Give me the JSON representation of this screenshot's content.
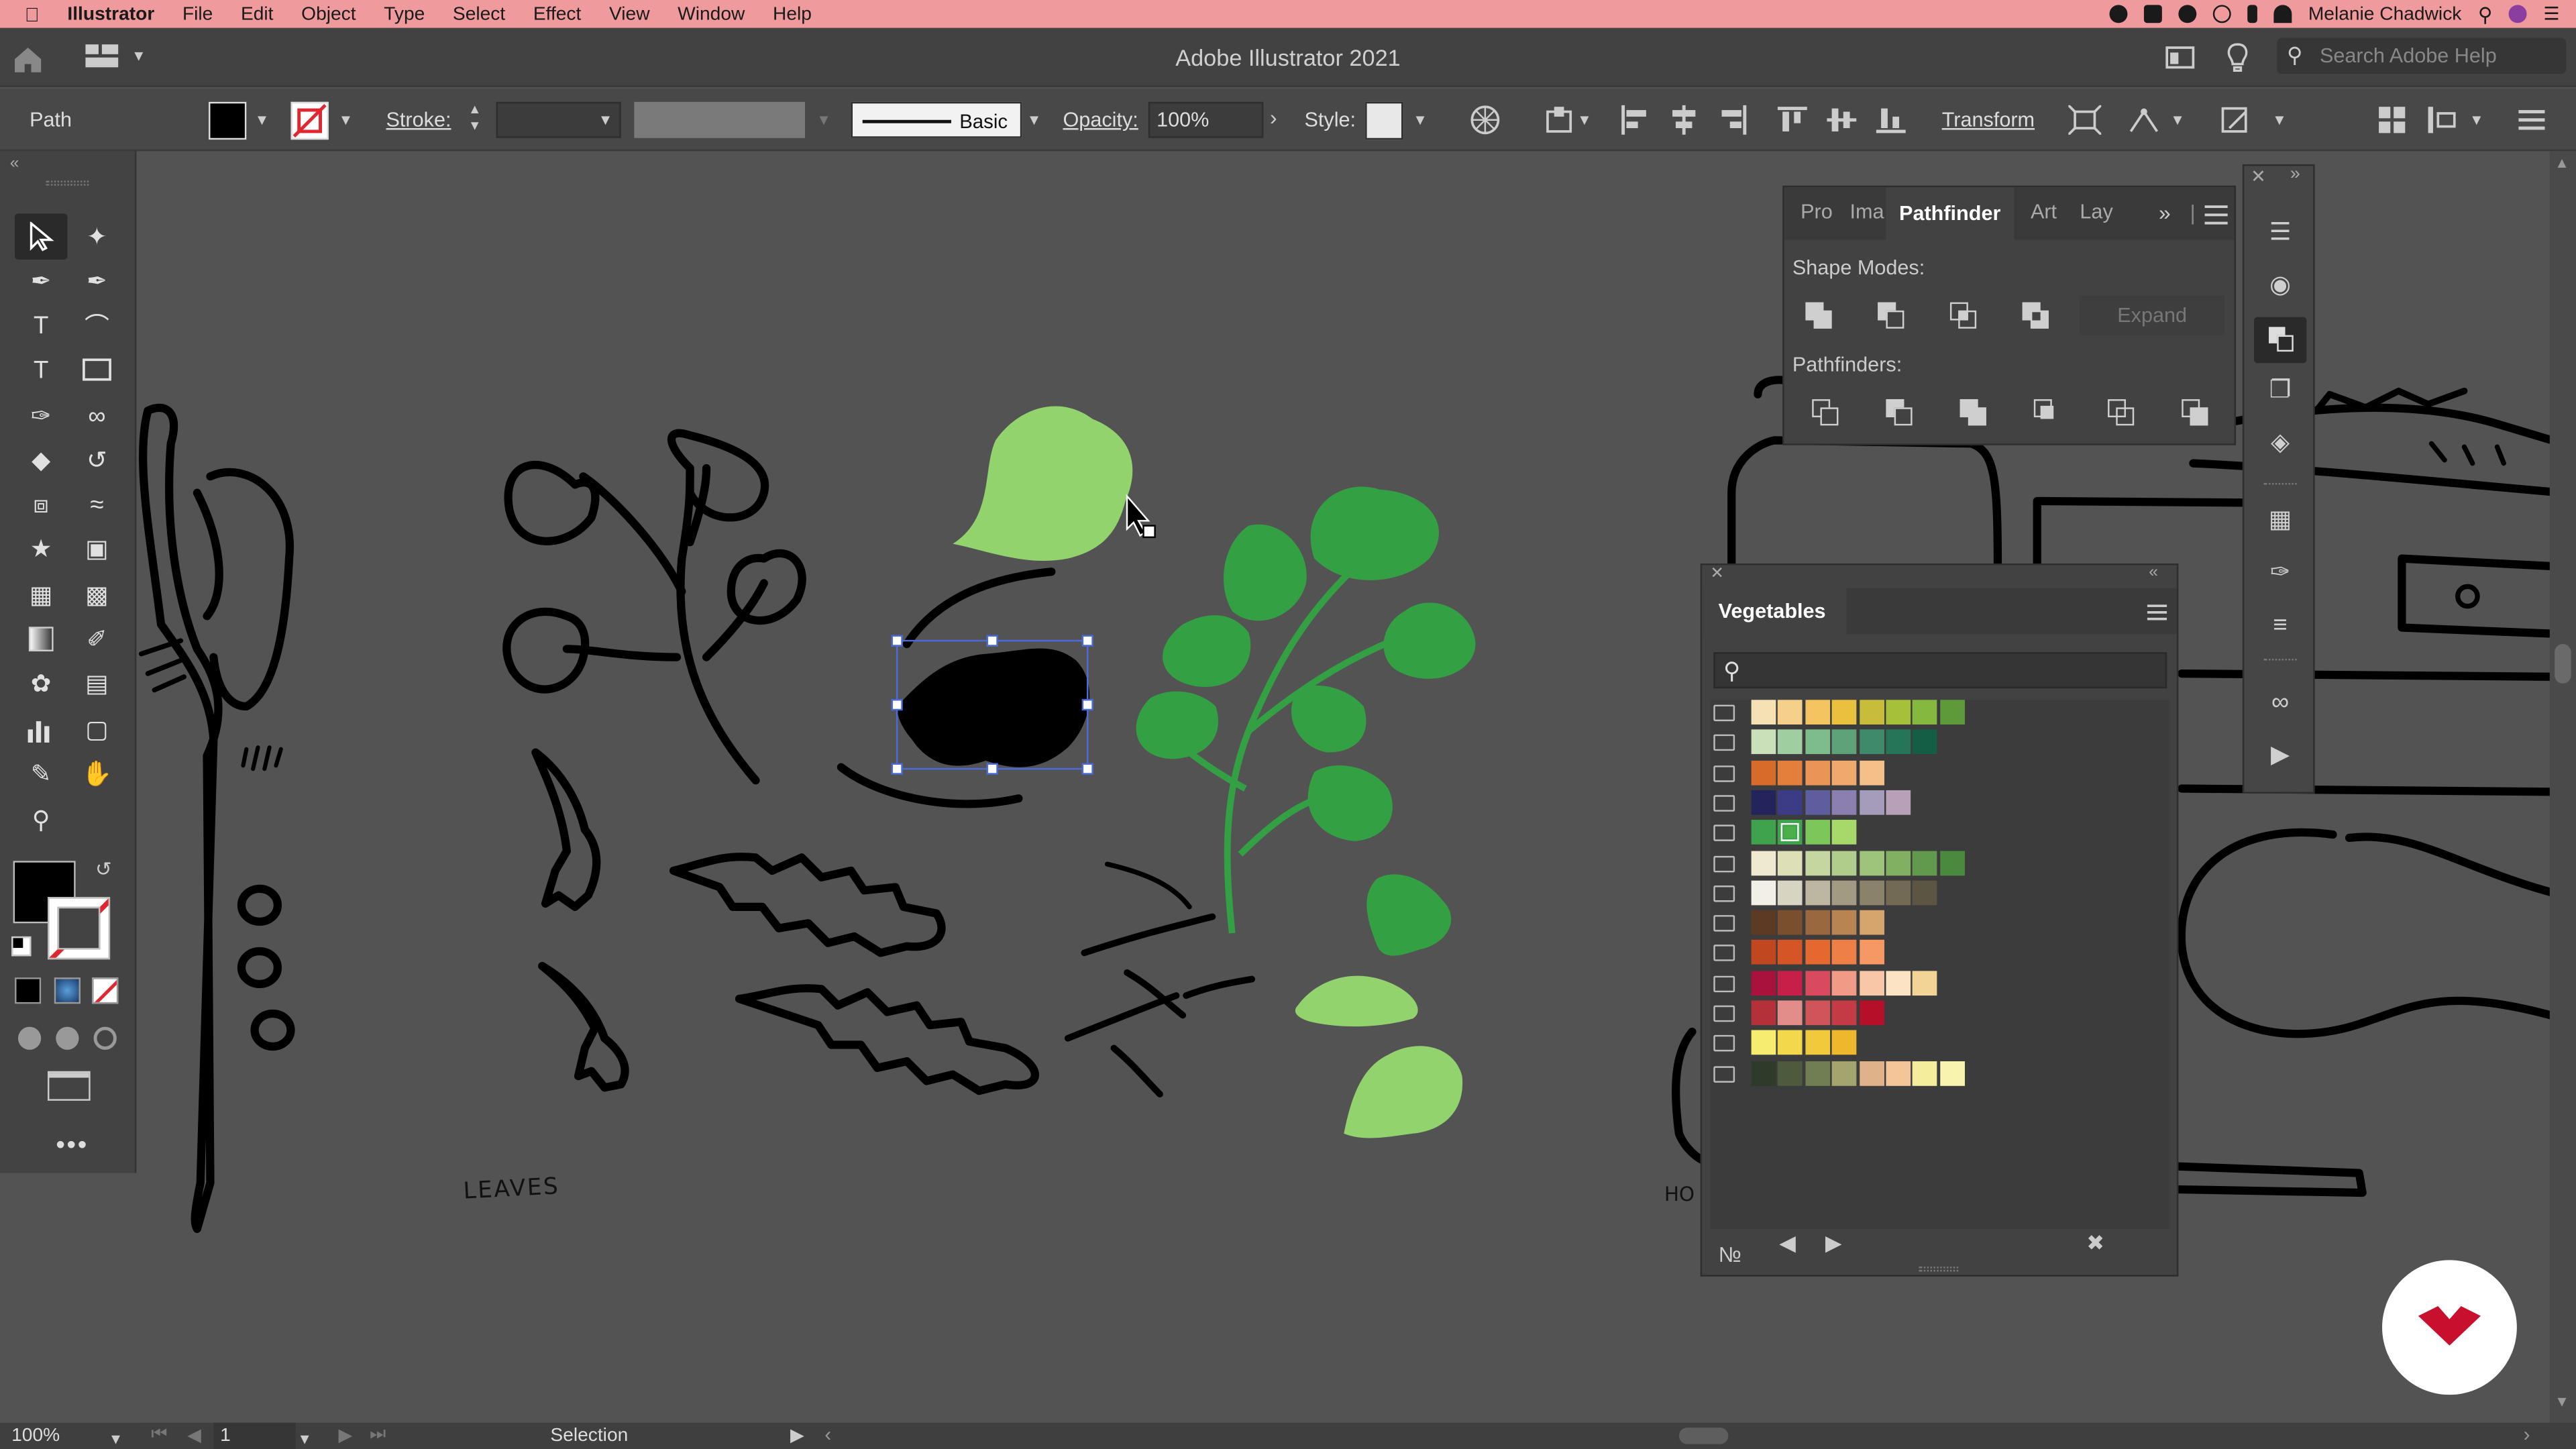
{
  "menubar": {
    "app": "Illustrator",
    "items": [
      "File",
      "Edit",
      "Object",
      "Type",
      "Select",
      "Effect",
      "View",
      "Window",
      "Help"
    ],
    "user": "Melanie Chadwick"
  },
  "titlebar": {
    "title": "Adobe Illustrator 2021",
    "search_placeholder": "Search Adobe Help"
  },
  "controlbar": {
    "selection_type": "Path",
    "stroke_label": "Stroke:",
    "brush_label": "Basic",
    "opacity_label": "Opacity:",
    "opacity_value": "100%",
    "style_label": "Style:",
    "transform_label": "Transform"
  },
  "pathfinder_panel": {
    "tabs": [
      "Pro",
      "Ima",
      "Pathfinder",
      "Art",
      "Lay"
    ],
    "active_tab": "Pathfinder",
    "shape_modes_label": "Shape Modes:",
    "expand_label": "Expand",
    "pathfinders_label": "Pathfinders:"
  },
  "swatches_panel": {
    "title": "Vegetables",
    "groups": [
      [
        "#f4e2b4",
        "#f5d08a",
        "#f3c45f",
        "#e9c13e",
        "#c8bd3a",
        "#a6c03a",
        "#84b83e",
        "#5f9a3a"
      ],
      [
        "#c9e0b9",
        "#9fcea0",
        "#7fbc8b",
        "#5ea27a",
        "#3f8a6a",
        "#267558",
        "#135e44"
      ],
      [
        "#d66b2a",
        "#e37f3a",
        "#ea9455",
        "#f0a96d",
        "#f5bf8a"
      ],
      [
        "#24245c",
        "#3b3b86",
        "#5e5e9e",
        "#8b7fb0",
        "#a59bbb",
        "#b8a0b8"
      ],
      [
        "#3fa34d",
        "#4cb04a",
        "#7dc75a",
        "#a6d86a"
      ],
      [
        "#efe9cf",
        "#dde0b6",
        "#c6d6a0",
        "#b1cd8b",
        "#9ec37a",
        "#82b063",
        "#629a4d",
        "#4a8a3f"
      ],
      [
        "#f2f0e6",
        "#d8d4c2",
        "#bdb6a0",
        "#a29a82",
        "#8a826a",
        "#726a55",
        "#5c5544"
      ],
      [
        "#5c3a23",
        "#7a4f2e",
        "#99683f",
        "#b88552",
        "#d6a56e"
      ],
      [
        "#c0471f",
        "#d65526",
        "#e5692f",
        "#ee7f47",
        "#f59863"
      ],
      [
        "#a8123d",
        "#c81f48",
        "#d94a5f",
        "#f19b86",
        "#f8c7a8",
        "#fbe3c3",
        "#f3d497"
      ],
      [
        "#b5313a",
        "#e28d8a",
        "#d0545a",
        "#c43a45",
        "#b50f2a"
      ],
      [
        "#f6ec6f",
        "#f4d84c",
        "#f2c93a",
        "#eeb72c"
      ],
      [
        "#2f3b2a",
        "#4e5a3d",
        "#717d52",
        "#a3a46e",
        "#e0b28a",
        "#f5c59a",
        "#f4ee9c",
        "#f8f4b0"
      ]
    ]
  },
  "canvas": {
    "label_leaves": "LEAVES",
    "label_ho": "HO"
  },
  "statusbar": {
    "zoom": "100%",
    "artboard": "1",
    "tool": "Selection"
  }
}
